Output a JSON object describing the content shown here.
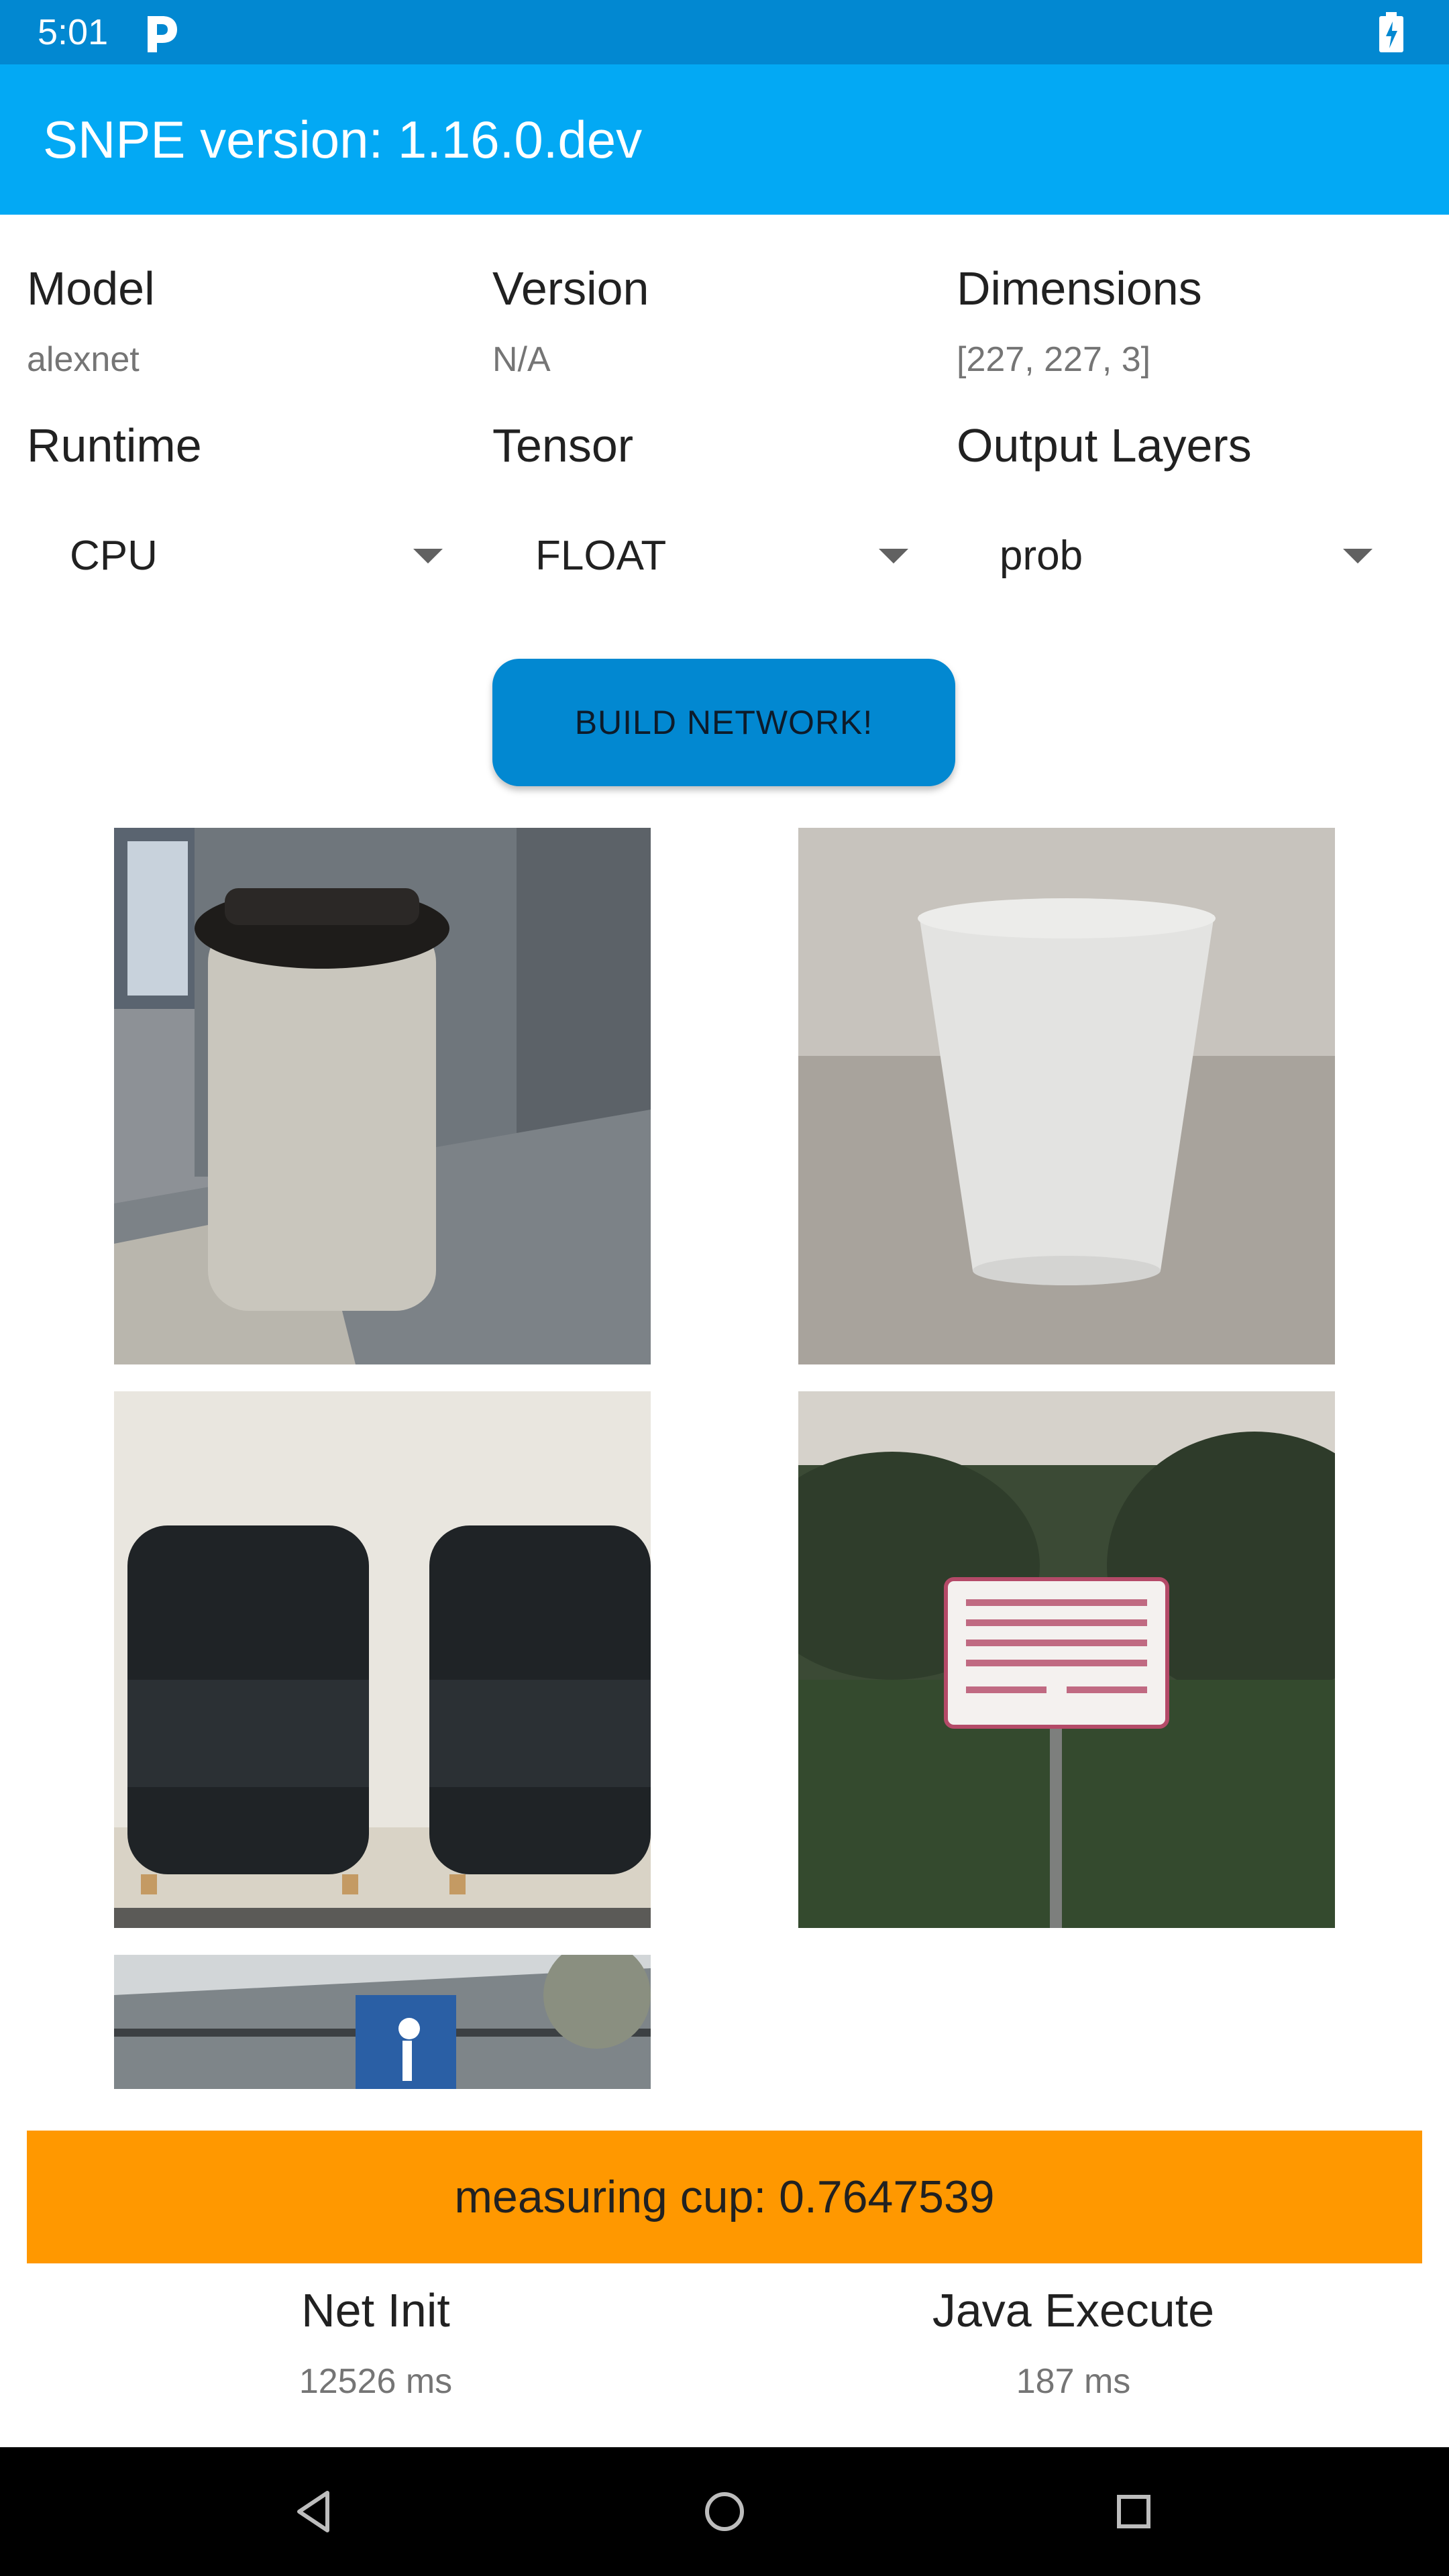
{
  "status_bar": {
    "time": "5:01",
    "icons": [
      "parking-p-icon",
      "battery-charging-icon"
    ]
  },
  "app_bar": {
    "title": "SNPE version: 1.16.0.dev"
  },
  "model_info": {
    "model": {
      "label": "Model",
      "value": "alexnet"
    },
    "version": {
      "label": "Version",
      "value": "N/A"
    },
    "dimensions": {
      "label": "Dimensions",
      "value": "[227, 227, 3]"
    }
  },
  "selectors": {
    "runtime": {
      "label": "Runtime",
      "selected": "CPU"
    },
    "tensor": {
      "label": "Tensor",
      "selected": "FLOAT"
    },
    "output_layers": {
      "label": "Output Layers",
      "selected": "prob"
    }
  },
  "build_button": {
    "label": "BUILD NETWORK!"
  },
  "images": [
    "trash-can-image",
    "plastic-cup-image",
    "leather-chairs-image",
    "recycled-water-sign-image",
    "parking-sign-image"
  ],
  "result": {
    "text": "measuring cup: 0.7647539"
  },
  "stats": {
    "net_init": {
      "label": "Net Init",
      "value": "12526 ms"
    },
    "java_execute": {
      "label": "Java Execute",
      "value": "187 ms"
    }
  },
  "colors": {
    "status_bar": "#0288d1",
    "app_bar": "#03a9f4",
    "button": "#0288d1",
    "result_banner": "#ff9800"
  }
}
